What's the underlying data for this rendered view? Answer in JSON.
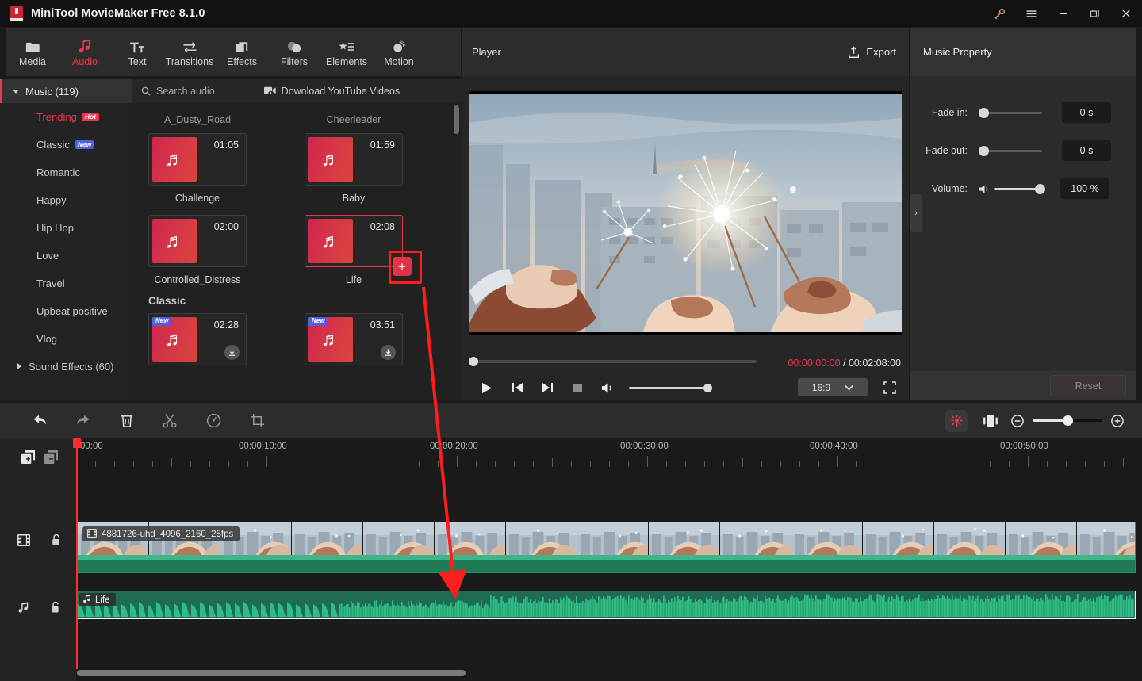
{
  "window": {
    "title": "MiniTool MovieMaker Free 8.1.0",
    "controls": [
      {
        "name": "key-icon",
        "glyph": "key"
      },
      {
        "name": "menu-icon",
        "glyph": "hamburger"
      },
      {
        "name": "minimize-icon",
        "glyph": "minimize"
      },
      {
        "name": "maximize-icon",
        "glyph": "maximize"
      },
      {
        "name": "close-icon",
        "glyph": "close"
      }
    ]
  },
  "ribbon": {
    "active": "Audio",
    "items": [
      {
        "label": "Media",
        "icon": "folder-icon"
      },
      {
        "label": "Audio",
        "icon": "music-note-icon"
      },
      {
        "label": "Text",
        "icon": "text-icon"
      },
      {
        "label": "Transitions",
        "icon": "transitions-icon"
      },
      {
        "label": "Effects",
        "icon": "effects-icon"
      },
      {
        "label": "Filters",
        "icon": "filters-icon"
      },
      {
        "label": "Elements",
        "icon": "elements-icon"
      },
      {
        "label": "Motion",
        "icon": "motion-icon"
      }
    ]
  },
  "sidebar": {
    "music_group": "Music (119)",
    "items": [
      {
        "label": "Trending",
        "badge": "Hot",
        "badge_type": "hot",
        "active": true
      },
      {
        "label": "Classic",
        "badge": "New",
        "badge_type": "new",
        "active": false
      },
      {
        "label": "Romantic",
        "badge": "",
        "badge_type": "",
        "active": false
      },
      {
        "label": "Happy",
        "badge": "",
        "badge_type": "",
        "active": false
      },
      {
        "label": "Hip Hop",
        "badge": "",
        "badge_type": "",
        "active": false
      },
      {
        "label": "Love",
        "badge": "",
        "badge_type": "",
        "active": false
      },
      {
        "label": "Travel",
        "badge": "",
        "badge_type": "",
        "active": false
      },
      {
        "label": "Upbeat positive",
        "badge": "",
        "badge_type": "",
        "active": false
      },
      {
        "label": "Vlog",
        "badge": "",
        "badge_type": "",
        "active": false
      }
    ],
    "sound_effects_group": "Sound Effects (60)"
  },
  "library": {
    "search_placeholder": "Search audio",
    "download_youtube": "Download YouTube Videos",
    "cut_names": [
      "A_Dusty_Road",
      "Cheerleader"
    ],
    "trending": [
      {
        "name": "Challenge",
        "duration": "01:05",
        "badge": "",
        "selected": false,
        "downloaded": true
      },
      {
        "name": "Baby",
        "duration": "01:59",
        "badge": "",
        "selected": false,
        "downloaded": true
      },
      {
        "name": "Controlled_Distress",
        "duration": "02:00",
        "badge": "",
        "selected": false,
        "downloaded": true
      },
      {
        "name": "Life",
        "duration": "02:08",
        "badge": "",
        "selected": true,
        "downloaded": true
      }
    ],
    "classic_title": "Classic",
    "classic": [
      {
        "name": "",
        "duration": "02:28",
        "badge": "New",
        "selected": false,
        "downloaded": false
      },
      {
        "name": "",
        "duration": "03:51",
        "badge": "New",
        "selected": false,
        "downloaded": false
      }
    ]
  },
  "player": {
    "title": "Player",
    "export_label": "Export",
    "current_time": "00:00:00:00",
    "separator": " / ",
    "total_time": "00:02:08:00",
    "aspect_ratio": "16:9",
    "controls": [
      "play-icon",
      "previous-frame-icon",
      "next-frame-icon",
      "stop-icon",
      "volume-icon"
    ]
  },
  "property": {
    "title": "Music Property",
    "rows": [
      {
        "label": "Fade in:",
        "value": "0 s",
        "knob_pct": 0
      },
      {
        "label": "Fade out:",
        "value": "0 s",
        "knob_pct": 0
      },
      {
        "label": "Volume:",
        "value": "100 %",
        "knob_pct": 100
      }
    ],
    "reset_label": "Reset",
    "collapse_glyph": "›"
  },
  "toolbar": {
    "left_tools": [
      {
        "name": "undo-button",
        "icon": "undo-icon"
      },
      {
        "name": "redo-button",
        "icon": "redo-icon"
      },
      {
        "name": "delete-button",
        "icon": "trash-icon"
      },
      {
        "name": "split-button",
        "icon": "scissors-icon"
      },
      {
        "name": "speed-button",
        "icon": "speed-gauge-icon"
      },
      {
        "name": "crop-button",
        "icon": "crop-icon"
      }
    ],
    "right_tools": [
      {
        "name": "auto-arrange-button",
        "icon": "sparkle-icon"
      },
      {
        "name": "fit-timeline-button",
        "icon": "fit-icon"
      }
    ],
    "zoom_out": "−",
    "zoom_in": "+"
  },
  "timeline": {
    "gutter_icons": [
      "add-track-icon",
      "remove-track-icon"
    ],
    "ruler_labels": [
      "00:00",
      "00:00:10:00",
      "00:00:20:00",
      "00:00:30:00",
      "00:00:40:00",
      "00:00:50:00"
    ],
    "video_track": {
      "icon": "film-icon",
      "lock_icon": "unlock-icon",
      "clip_name": "4881726-uhd_4096_2160_25fps",
      "clip_icon": "film-strip-icon"
    },
    "audio_track": {
      "icon": "music-note-icon",
      "lock_icon": "unlock-icon",
      "clip_name": "Life",
      "clip_icon": "music-note-icon"
    }
  },
  "annotation": {
    "color": "#ff1d1d",
    "highlight_target": "add-to-timeline-button"
  }
}
